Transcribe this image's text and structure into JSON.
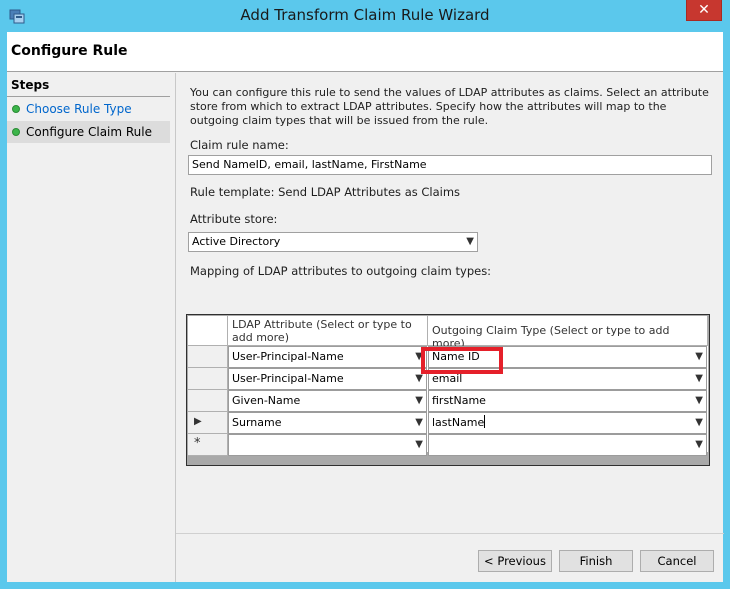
{
  "window": {
    "title": "Add Transform Claim Rule Wizard",
    "close_glyph": "✕"
  },
  "header": {
    "title": "Configure Rule"
  },
  "steps": {
    "heading": "Steps",
    "items": [
      {
        "label": "Choose Rule Type",
        "status": "complete"
      },
      {
        "label": "Configure Claim Rule",
        "status": "current"
      }
    ]
  },
  "main": {
    "description": "You can configure this rule to send the values of LDAP attributes as claims. Select an attribute store from which to extract LDAP attributes. Specify how the attributes will map to the outgoing claim types that will be issued from the rule.",
    "claim_rule_name_label": "Claim rule name:",
    "claim_rule_name_value": "Send NameID, email, lastName, FirstName",
    "rule_template": "Rule template: Send LDAP Attributes as Claims",
    "attribute_store_label": "Attribute store:",
    "attribute_store_value": "Active Directory",
    "mapping_label": "Mapping of LDAP attributes to outgoing claim types:"
  },
  "grid": {
    "columns": [
      "LDAP Attribute (Select or type to add more)",
      "Outgoing Claim Type (Select or type to add more)"
    ],
    "rows": [
      {
        "marker": "",
        "ldap": "User-Principal-Name",
        "claim": "Name ID"
      },
      {
        "marker": "",
        "ldap": "User-Principal-Name",
        "claim": "email"
      },
      {
        "marker": "",
        "ldap": "Given-Name",
        "claim": "firstName"
      },
      {
        "marker": "▶",
        "ldap": "Surname",
        "claim": "lastName"
      },
      {
        "marker": "*",
        "ldap": "",
        "claim": ""
      }
    ]
  },
  "buttons": {
    "previous": "< Previous",
    "finish": "Finish",
    "cancel": "Cancel"
  },
  "colors": {
    "title_bar": "#5bc8ec",
    "highlight_box": "#e5202a",
    "step_dot": "#3cb54a",
    "link": "#0066cc"
  }
}
